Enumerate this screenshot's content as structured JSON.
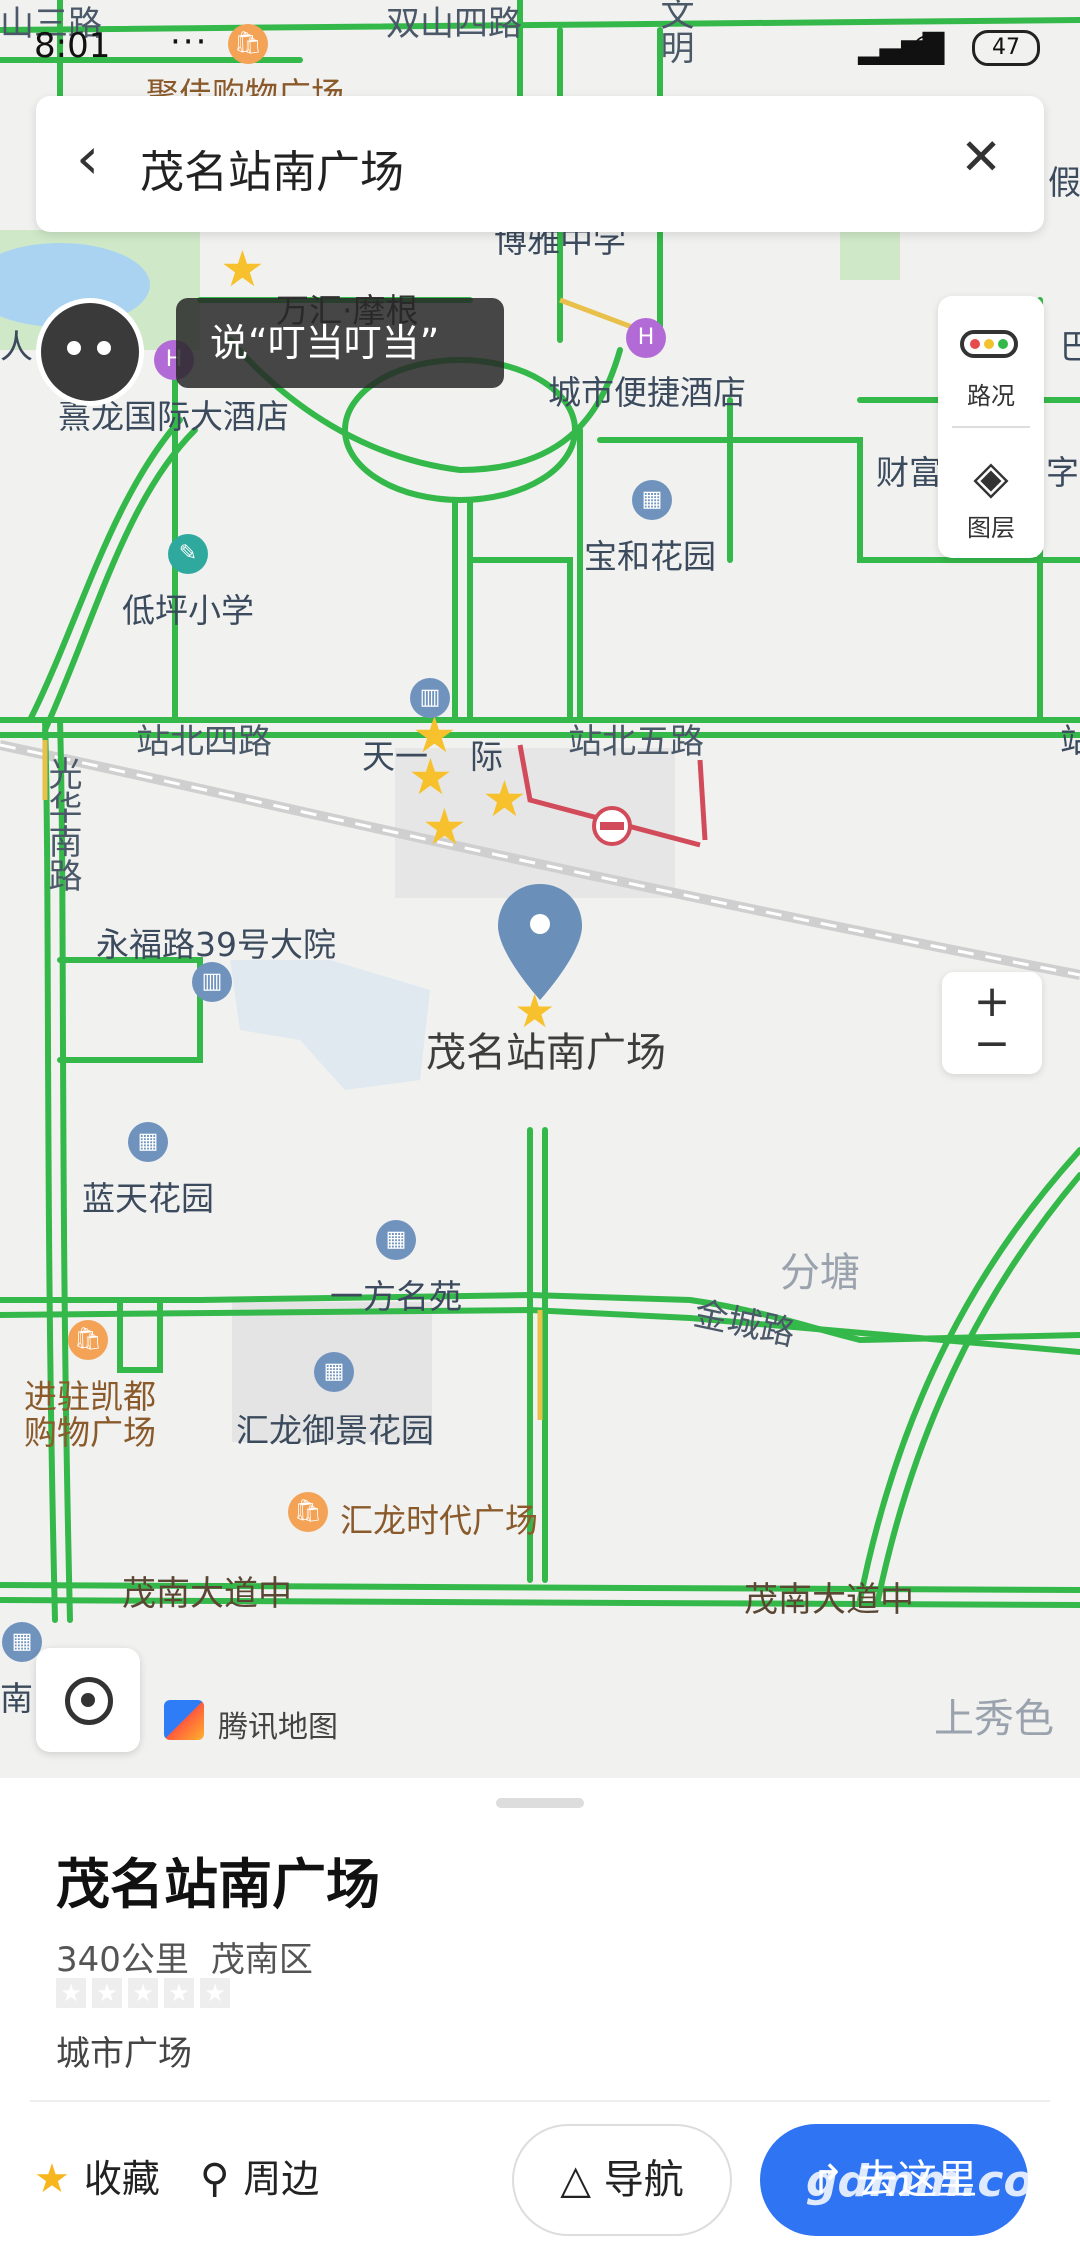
{
  "status_bar": {
    "time": "8:01",
    "more": "···",
    "battery": "47"
  },
  "search": {
    "query": "茂名站南广场"
  },
  "voice": {
    "prompt": "说“叮当叮当”"
  },
  "controls": {
    "traffic_label": "路况",
    "layer_label": "图层",
    "zoom_in": "+",
    "zoom_out": "−"
  },
  "map": {
    "roads": [
      "双山四路",
      "站北四路",
      "站北五路",
      "光华南路",
      "金城路",
      "茂南大道中",
      "茂南大道中",
      "山三路",
      "文明"
    ],
    "places": {
      "juhe": "聚佳购物广场",
      "wanhui": "万汇·摩根",
      "jialong_hotel": "熹龙国际大酒店",
      "city_hotel": "城市便捷酒店",
      "boya": "博雅中学",
      "baohe": "宝和花园",
      "caifu": "财富",
      "dipingxiao": "低坪小学",
      "tianyi": "天一",
      "tianyi2": "际",
      "yongfu": "永福路39号大院",
      "target": "茂名站南广场",
      "lantian": "蓝天花园",
      "yifang": "一方名苑",
      "fentang": "分塘",
      "kaidu": "进驻凯都",
      "kaidu2": "购物广场",
      "huilong_garden": "汇龙御景花园",
      "huilong_plaza": "汇龙时代广场",
      "shangxiuse": "上秀色",
      "edge_left1": "人",
      "edge_left2": "南",
      "edge_right1": "假",
      "edge_right2": "字",
      "edge_right3": "站",
      "edge_right4": "巴"
    },
    "brand": "腾讯地图"
  },
  "sheet": {
    "title": "茂名站南广场",
    "distance": "340公里",
    "district": "茂南区",
    "category": "城市广场",
    "rating": 0,
    "actions": {
      "favorite": "收藏",
      "nearby": "周边",
      "navigate": "导航",
      "go": "去这里"
    }
  },
  "watermark": "gdmm.com",
  "colors": {
    "road_green": "#35b84a",
    "accent_blue": "#2f74f3",
    "pin": "#6a8fb8",
    "star": "#f7c12e"
  }
}
